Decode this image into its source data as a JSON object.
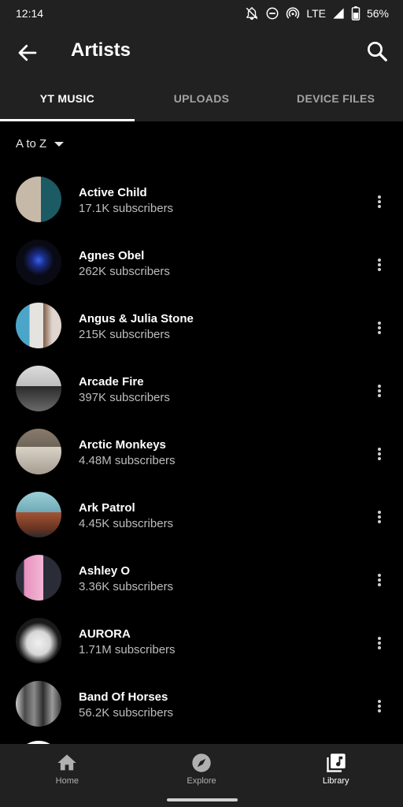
{
  "status": {
    "time": "12:14",
    "network": "LTE",
    "battery": "56%"
  },
  "header": {
    "title": "Artists"
  },
  "tabs": [
    {
      "label": "YT MUSIC",
      "active": true
    },
    {
      "label": "UPLOADS",
      "active": false
    },
    {
      "label": "DEVICE FILES",
      "active": false
    }
  ],
  "sort": {
    "label": "A to Z"
  },
  "artists": [
    {
      "name": "Active Child",
      "subscribers": "17.1K subscribers",
      "avatar_colors": [
        "#1c5b63",
        "#c7b9a8"
      ]
    },
    {
      "name": "Agnes Obel",
      "subscribers": "262K subscribers",
      "avatar_colors": [
        "#0a0a14",
        "#2e52d4"
      ]
    },
    {
      "name": "Angus & Julia Stone",
      "subscribers": "215K subscribers",
      "avatar_colors": [
        "#e5e3df",
        "#4ba5c8"
      ]
    },
    {
      "name": "Arcade Fire",
      "subscribers": "397K subscribers",
      "avatar_colors": [
        "#cfcfcf",
        "#2a2a2a"
      ]
    },
    {
      "name": "Arctic Monkeys",
      "subscribers": "4.48M subscribers",
      "avatar_colors": [
        "#6e6459",
        "#d8d2c6"
      ]
    },
    {
      "name": "Ark Patrol",
      "subscribers": "4.45K subscribers",
      "avatar_colors": [
        "#6fa8b6",
        "#a15535"
      ]
    },
    {
      "name": "Ashley O",
      "subscribers": "3.36K subscribers",
      "avatar_colors": [
        "#e78fbf",
        "#2a2d38"
      ]
    },
    {
      "name": "AURORA",
      "subscribers": "1.71M subscribers",
      "avatar_colors": [
        "#1a1a1a",
        "#e8e8e8"
      ]
    },
    {
      "name": "Band Of Horses",
      "subscribers": "56.2K subscribers",
      "avatar_colors": [
        "#c9c9c9",
        "#3a3a3a"
      ]
    }
  ],
  "bottom_nav": [
    {
      "label": "Home",
      "active": false
    },
    {
      "label": "Explore",
      "active": false
    },
    {
      "label": "Library",
      "active": true
    }
  ]
}
